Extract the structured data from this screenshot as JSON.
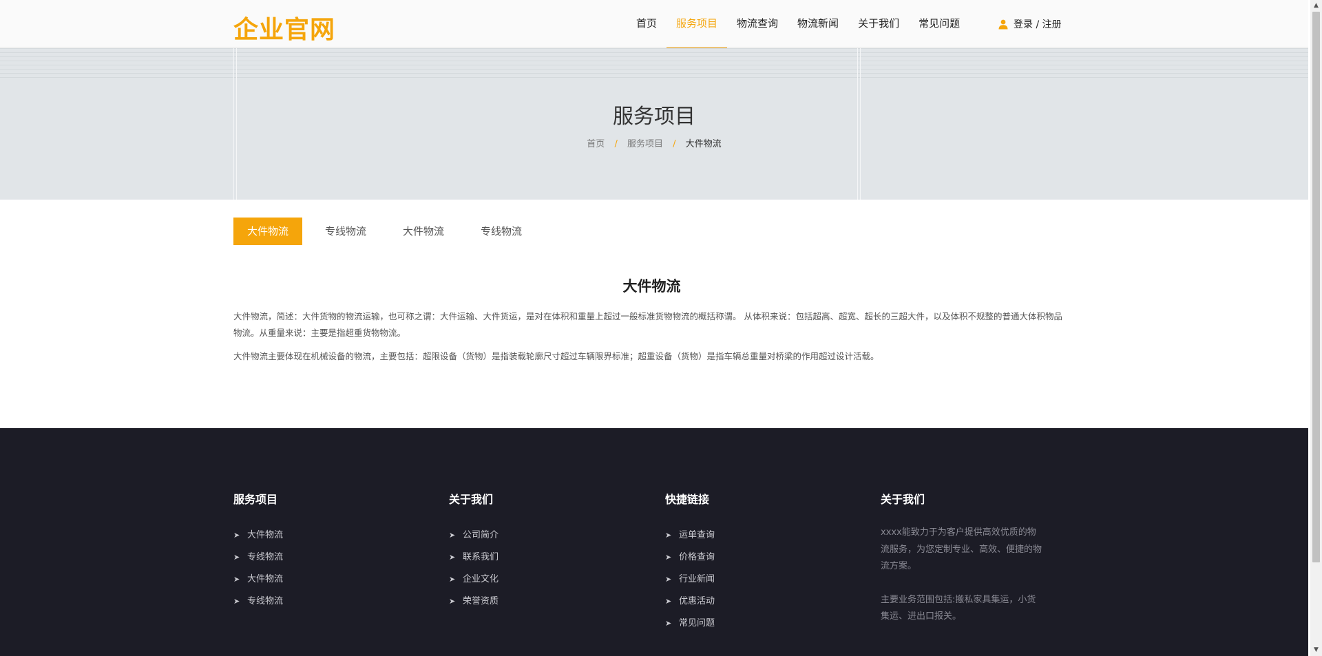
{
  "header": {
    "logo": "企业官网",
    "nav": [
      {
        "label": "首页"
      },
      {
        "label": "服务项目",
        "active": true
      },
      {
        "label": "物流查询"
      },
      {
        "label": "物流新闻"
      },
      {
        "label": "关于我们"
      },
      {
        "label": "常见问题"
      }
    ],
    "login_label": "登录 / 注册"
  },
  "banner": {
    "title": "服务项目",
    "breadcrumb": [
      "首页",
      "服务项目",
      "大件物流"
    ],
    "separator": "/"
  },
  "tabs": [
    {
      "label": "大件物流",
      "active": true
    },
    {
      "label": "专线物流"
    },
    {
      "label": "大件物流"
    },
    {
      "label": "专线物流"
    }
  ],
  "content": {
    "title": "大件物流",
    "paragraphs": [
      "大件物流，简述：大件货物的物流运输，也可称之谓：大件运输、大件货运，是对在体积和重量上超过一般标准货物物流的概括称谓。 从体积来说：包括超高、超宽、超长的三超大件，以及体积不规整的普通大体积物品物流。从重量来说：主要是指超重货物物流。",
      "大件物流主要体现在机械设备的物流，主要包括：超限设备（货物）是指装载轮廓尺寸超过车辆限界标准；超重设备（货物）是指车辆总重量对桥梁的作用超过设计活载。"
    ]
  },
  "footer": {
    "col1": {
      "title": "服务项目",
      "items": [
        "大件物流",
        "专线物流",
        "大件物流",
        "专线物流"
      ]
    },
    "col2": {
      "title": "关于我们",
      "items": [
        "公司简介",
        "联系我们",
        "企业文化",
        "荣誉资质"
      ]
    },
    "col3": {
      "title": "快捷链接",
      "items": [
        "运单查询",
        "价格查询",
        "行业新闻",
        "优惠活动",
        "常见问题"
      ]
    },
    "col4": {
      "title": "关于我们",
      "paragraphs": [
        "xxxx能致力于为客户提供高效优质的物流服务，为您定制专业、高效、便捷的物流方案。",
        "主要业务范围包括:搬私家具集运，小货集运、进出口报关。"
      ]
    }
  },
  "colors": {
    "accent": "#f5a50b",
    "footer_bg": "#1c1c26",
    "banner_bg": "#e1e5e8"
  },
  "icons": {
    "login": "user-icon",
    "footer_list": "arrow-right-icon"
  }
}
